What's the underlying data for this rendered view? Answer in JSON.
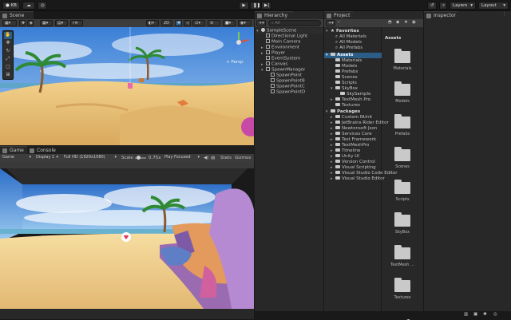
{
  "topbar": {
    "account": "KB",
    "layers_label": "Layers",
    "layout_label": "Layout"
  },
  "scene": {
    "tab_label": "Scene",
    "persp_label": "< Persp"
  },
  "game": {
    "tab_game": "Game",
    "tab_console": "Console",
    "toolbar": {
      "mode": "Game",
      "display": "Display 1",
      "resolution": "Full HD (1920x1080)",
      "scale_label": "Scale",
      "scale_value": "0.75x",
      "play_focused": "Play Focused",
      "stats": "Stats",
      "gizmos": "Gizmos"
    }
  },
  "hierarchy": {
    "tab_label": "Hierarchy",
    "search_placeholder": "All",
    "scene_name": "SampleScene",
    "items": [
      {
        "label": "Directional Light"
      },
      {
        "label": "Main Camera"
      },
      {
        "label": "Environment"
      },
      {
        "label": "Player"
      },
      {
        "label": "EventSystem"
      },
      {
        "label": "Canvas"
      },
      {
        "label": "SpawnManager"
      },
      {
        "label": "SpawnPoint"
      },
      {
        "label": "SpawnPointB"
      },
      {
        "label": "SpawnPointC"
      },
      {
        "label": "SpawnPointD"
      }
    ]
  },
  "project": {
    "tab_label": "Project",
    "favorites_label": "Favorites",
    "favorites": [
      {
        "label": "All Materials"
      },
      {
        "label": "All Models"
      },
      {
        "label": "All Prefabs"
      }
    ],
    "assets_label": "Assets",
    "assets_tree": [
      {
        "label": "Materials"
      },
      {
        "label": "Models"
      },
      {
        "label": "Prefabs"
      },
      {
        "label": "Scenes"
      },
      {
        "label": "Scripts"
      },
      {
        "label": "SkyBox"
      },
      {
        "label": "SkySample"
      },
      {
        "label": "TextMesh Pro"
      },
      {
        "label": "Textures"
      }
    ],
    "packages_label": "Packages",
    "packages": [
      {
        "label": "Custom NUnit"
      },
      {
        "label": "JetBrains Rider Editor"
      },
      {
        "label": "Newtonsoft Json"
      },
      {
        "label": "Services Core"
      },
      {
        "label": "Test Framework"
      },
      {
        "label": "TextMeshPro"
      },
      {
        "label": "Timeline"
      },
      {
        "label": "Unity UI"
      },
      {
        "label": "Version Control"
      },
      {
        "label": "Visual Scripting"
      },
      {
        "label": "Visual Studio Code Editor"
      },
      {
        "label": "Visual Studio Editor"
      }
    ],
    "assets_header": "Assets",
    "grid": [
      {
        "label": "Materials"
      },
      {
        "label": "Models"
      },
      {
        "label": "Prefabs"
      },
      {
        "label": "Scenes"
      },
      {
        "label": "Scripts"
      },
      {
        "label": "SkyBox"
      },
      {
        "label": "TextMesh ..."
      },
      {
        "label": "Textures"
      }
    ]
  },
  "inspector": {
    "tab_label": "Inspector"
  },
  "colors": {
    "accent": "#2c5d87",
    "panel_bg": "#282828",
    "toolbar_bg": "#3c3c3c",
    "sky": "#3a7fd6",
    "sand": "#e9c07a"
  }
}
